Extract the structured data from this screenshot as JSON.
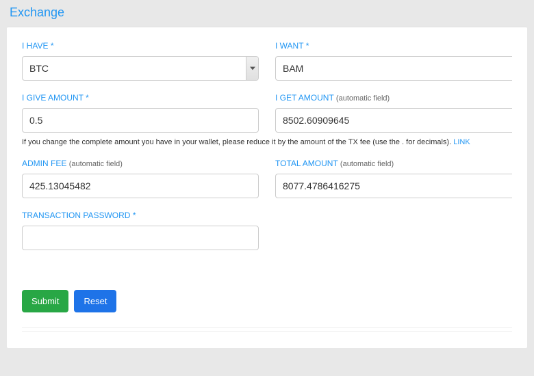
{
  "title": "Exchange",
  "labels": {
    "i_have": "I HAVE",
    "i_want": "I WANT",
    "i_give_amount": "I GIVE AMOUNT",
    "i_get_amount": "I GET AMOUNT",
    "admin_fee": "ADMIN FEE",
    "total_amount": "TOTAL AMOUNT",
    "transaction_password": "TRANSACTION PASSWORD",
    "automatic_field": "(automatic field)",
    "required": "*"
  },
  "values": {
    "i_have": "BTC",
    "i_want": "BAM",
    "i_give_amount": "0.5",
    "i_get_amount": "8502.60909645",
    "admin_fee": "425.13045482",
    "total_amount": "8077.4786416275",
    "transaction_password": ""
  },
  "help_text": {
    "text": "If you change the complete amount you have in your wallet, please reduce it by the amount of the TX fee (use the . for decimals). ",
    "link": "LINK"
  },
  "buttons": {
    "submit": "Submit",
    "reset": "Reset"
  }
}
